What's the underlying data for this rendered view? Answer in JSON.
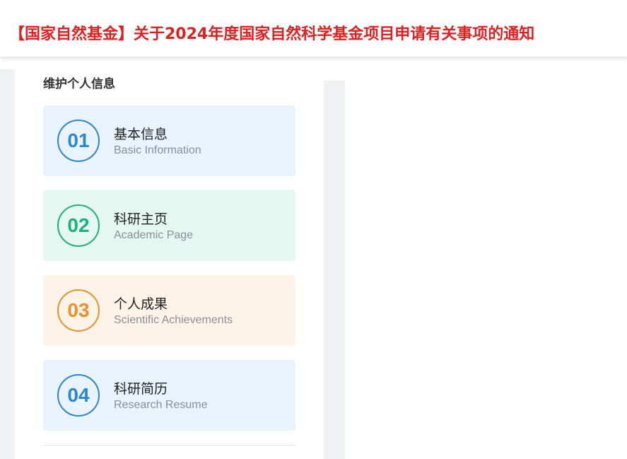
{
  "banner": {
    "title": "【国家自然基金】关于2024年度国家自然科学基金项目申请有关事项的通知"
  },
  "panel": {
    "title": "维护个人信息",
    "cards": [
      {
        "number": "01",
        "title": "基本信息",
        "subtitle": "Basic Information",
        "accent": "#2b87d1",
        "background": "#e8f3fd",
        "icon": "number-badge-icon"
      },
      {
        "number": "02",
        "title": "科研主页",
        "subtitle": "Academic Page",
        "accent": "#1fb07f",
        "background": "#e4f7f1",
        "icon": "number-badge-icon"
      },
      {
        "number": "03",
        "title": "个人成果",
        "subtitle": "Scientific Achievements",
        "accent": "#e8922a",
        "background": "#fdf3e8",
        "icon": "number-badge-icon"
      },
      {
        "number": "04",
        "title": "科研简历",
        "subtitle": "Research Resume",
        "accent": "#2b87d1",
        "background": "#e8f3fd",
        "icon": "number-badge-icon"
      }
    ]
  }
}
